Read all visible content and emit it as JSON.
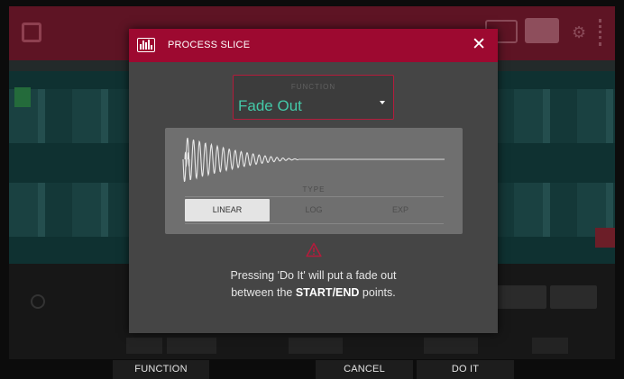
{
  "dialog": {
    "title": "PROCESS SLICE",
    "logo_icon": "waveform-slice-icon",
    "close_icon": "close-icon"
  },
  "function_select": {
    "label": "FUNCTION",
    "value": "Fade Out",
    "accent": "#44c9a8",
    "border": "#b31c3c"
  },
  "type_selector": {
    "label": "TYPE",
    "options": [
      "LINEAR",
      "LOG",
      "EXP"
    ],
    "selected": "LINEAR"
  },
  "warning": {
    "icon": "warning-triangle-icon",
    "color": "#b31c3c",
    "message_pre": "Pressing 'Do It' will put a fade out",
    "message_line2_pre": "between the ",
    "message_bold": "START/END",
    "message_line2_post": " points."
  },
  "softkeys": {
    "function": "FUNCTION",
    "cancel": "CANCEL",
    "do_it": "DO IT"
  },
  "colors": {
    "header": "#9d0930",
    "dialog_bg": "#454545",
    "panel_bg": "#6f6f6f"
  }
}
